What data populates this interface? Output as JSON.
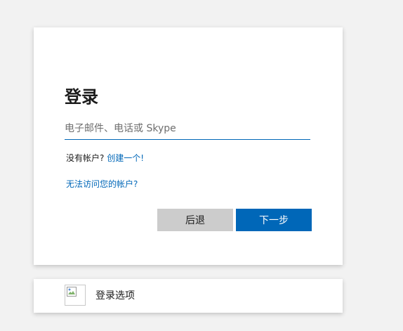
{
  "login": {
    "title": "登录",
    "email_placeholder": "电子邮件、电话或 Skype",
    "no_account_text": "没有帐户?",
    "create_link": "创建一个!",
    "cant_access_link": "无法访问您的帐户?",
    "back_button": "后退",
    "next_button": "下一步"
  },
  "options": {
    "label": "登录选项",
    "icon": "broken-image-icon"
  },
  "colors": {
    "accent": "#0067b8",
    "back_button_bg": "#cccccc",
    "page_bg": "#f2f2f2"
  }
}
